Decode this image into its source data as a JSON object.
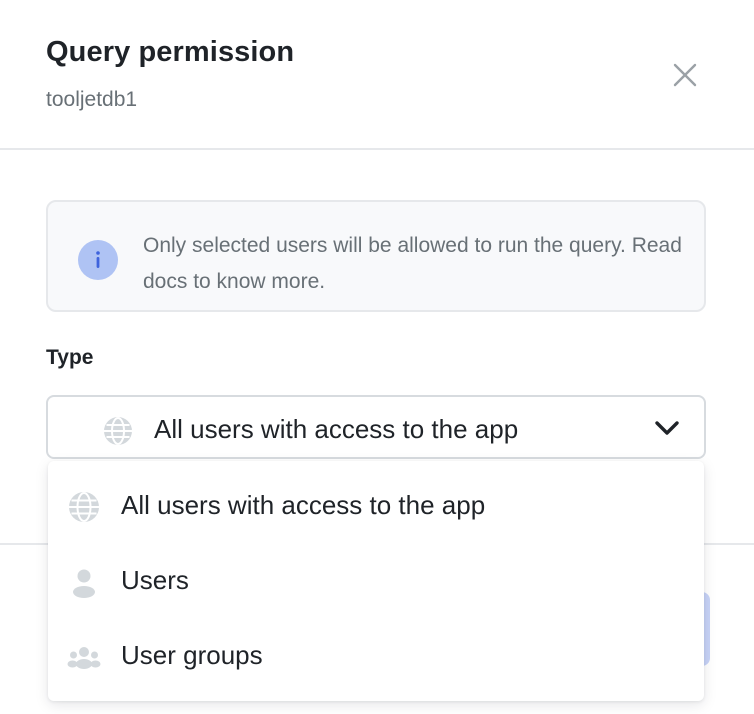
{
  "dialog": {
    "title": "Query permission",
    "subtitle": "tooljetdb1",
    "close_icon": "close-icon"
  },
  "info": {
    "icon": "info-icon",
    "text": "Only selected users will be allowed to run the query. Read docs to know more."
  },
  "type_field": {
    "label": "Type",
    "selected_value": "All users with access to the app",
    "selected_icon": "globe-icon",
    "chevron_icon": "chevron-down-icon"
  },
  "dropdown": {
    "options": [
      {
        "label": "All users with access to the app",
        "icon": "globe-icon"
      },
      {
        "label": "Users",
        "icon": "user-icon"
      },
      {
        "label": "User groups",
        "icon": "user-group-icon"
      }
    ]
  },
  "colors": {
    "title": "#1f2328",
    "muted_text": "#687076",
    "info_icon_bg": "#afc3f4",
    "info_icon_fg": "#3e63dd",
    "border": "#e6e8eb",
    "icon_gray": "#c1c8cd"
  }
}
